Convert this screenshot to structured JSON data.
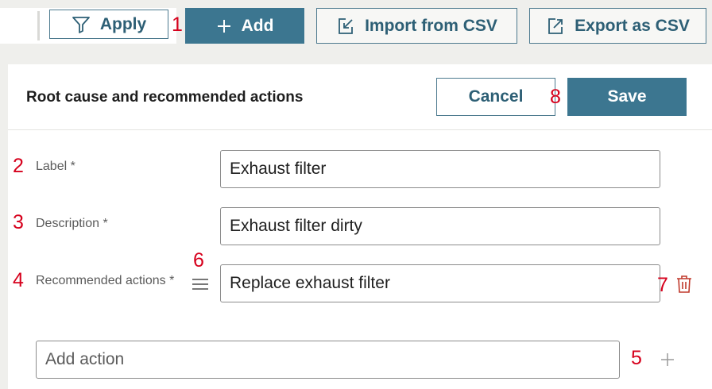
{
  "toolbar": {
    "apply_label": "Apply",
    "add_label": "Add",
    "import_label": "Import from CSV",
    "export_label": "Export as CSV"
  },
  "panel": {
    "title": "Root cause and recommended actions",
    "cancel_label": "Cancel",
    "save_label": "Save"
  },
  "form": {
    "label_field": {
      "label": "Label *",
      "value": "Exhaust filter"
    },
    "description_field": {
      "label": "Description *",
      "value": "Exhaust filter dirty"
    },
    "actions_field": {
      "label": "Recommended actions *",
      "value": "Replace exhaust filter"
    },
    "add_action": {
      "placeholder": "Add action"
    }
  },
  "annotations": [
    "1",
    "2",
    "3",
    "4",
    "5",
    "6",
    "7",
    "8"
  ],
  "colors": {
    "primary": "#3c7690",
    "outline": "#4d7a8f",
    "annotation": "#d6001c",
    "delete_icon": "#c0392b"
  },
  "icons": [
    "filter-icon",
    "plus-icon",
    "import-icon",
    "export-icon",
    "drag-handle-icon",
    "trash-icon",
    "add-plus-icon"
  ]
}
